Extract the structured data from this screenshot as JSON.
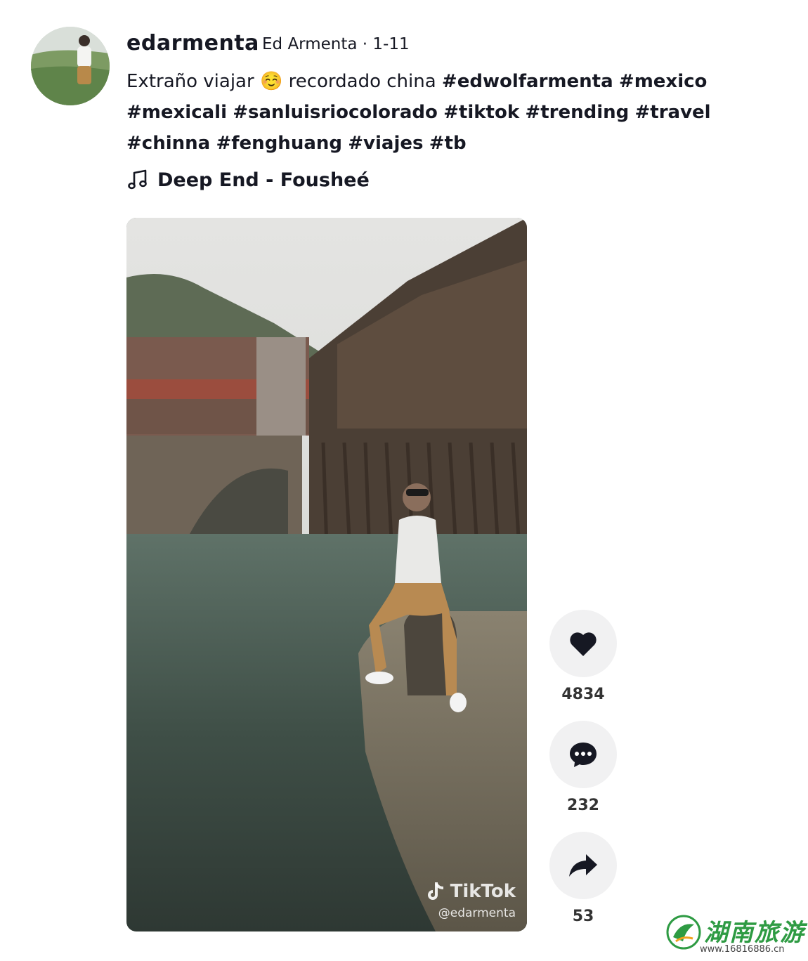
{
  "author": {
    "username": "edarmenta",
    "meta": "Ed Armenta · 1-11"
  },
  "caption": {
    "text": "Extraño viajar",
    "emoji": "☺️",
    "text2": "recordado china",
    "hashtags": [
      "#edwolfarmenta",
      "#mexico",
      "#mexicali",
      "#sanluisriocolorado",
      "#tiktok",
      "#trending",
      "#travel",
      "#chinna",
      "#fenghuang",
      "#viajes",
      "#tb"
    ]
  },
  "music": {
    "icon": "music-note-icon",
    "title": "Deep End - Fousheé"
  },
  "video": {
    "watermark_brand": "TikTok",
    "watermark_handle": "@edarmenta"
  },
  "actions": {
    "likes": "4834",
    "comments": "232",
    "shares": "53"
  },
  "site_watermark": {
    "name": "湖南旅游",
    "url": "www.16816886.cn"
  },
  "colors": {
    "text": "#161823",
    "action_bg": "#f1f1f2",
    "count": "#333333",
    "site_green": "#2e9b43"
  }
}
